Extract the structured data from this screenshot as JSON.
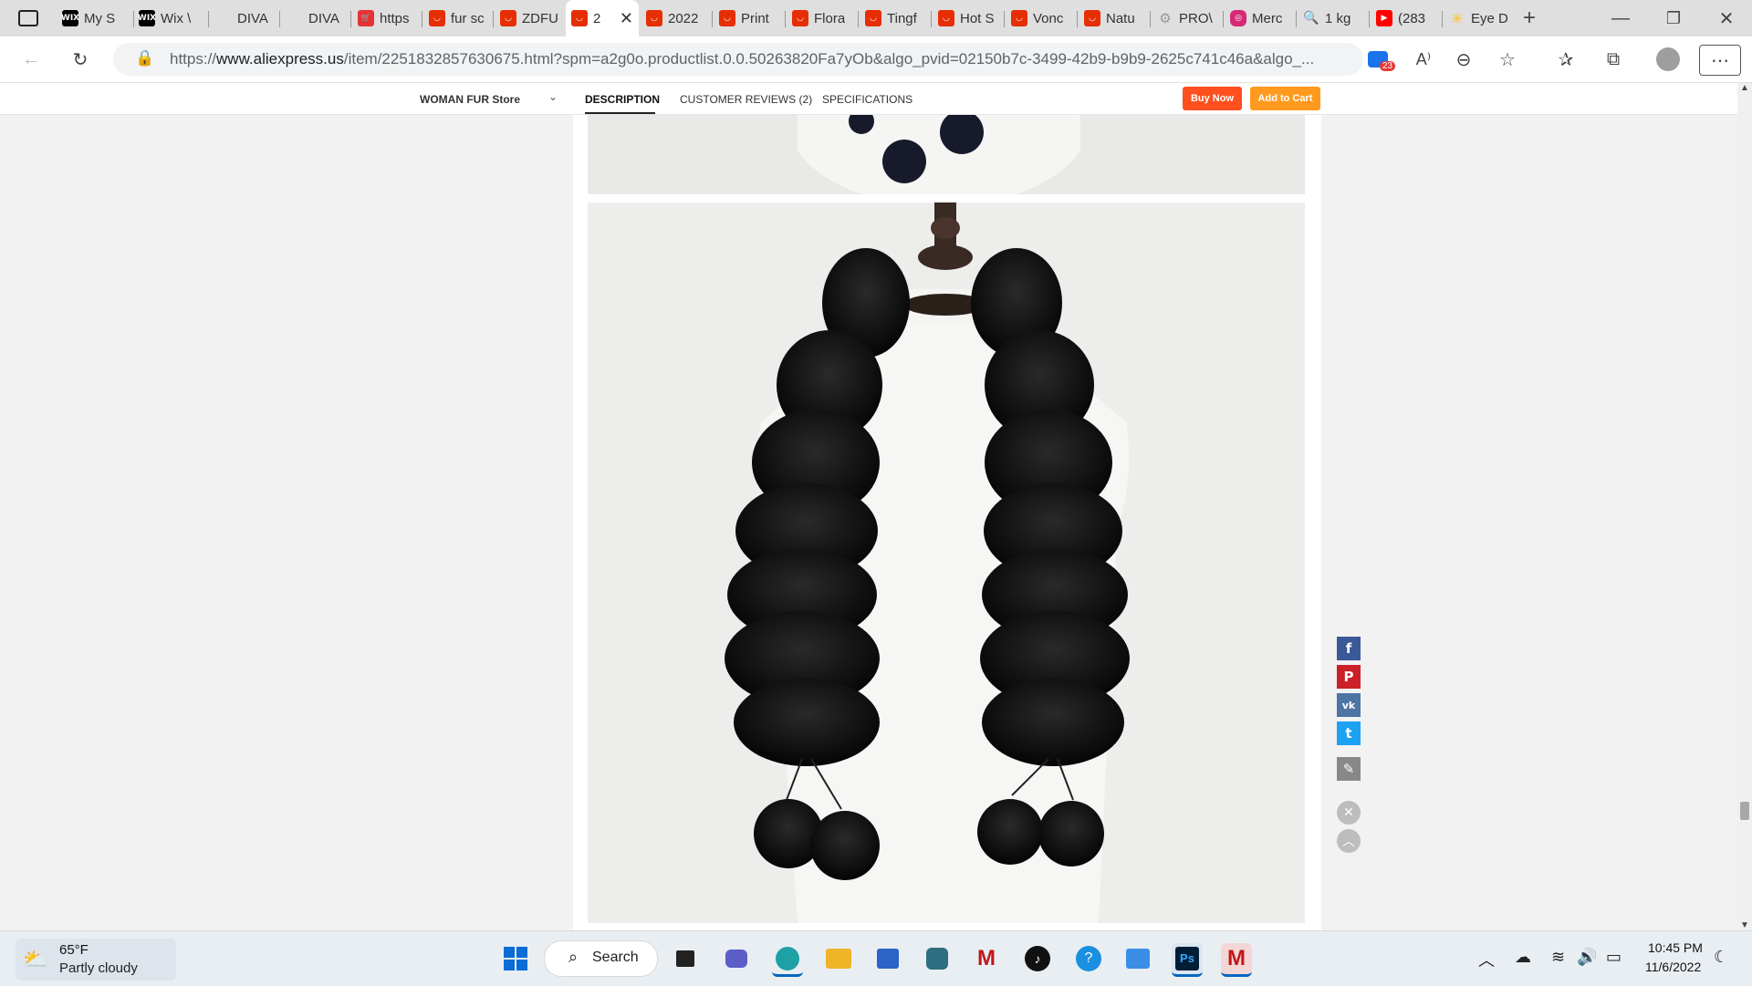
{
  "browser": {
    "tabs": [
      {
        "title": "",
        "icon": "window-menu-icon",
        "color": "#222222"
      },
      {
        "title": "My S",
        "icon": "wix-icon",
        "color": "#000000"
      },
      {
        "title": "Wix \\",
        "icon": "wix-icon",
        "color": "#000000"
      },
      {
        "title": "DIVA",
        "icon": "blank-icon",
        "color": "#dfdfdf"
      },
      {
        "title": "DIVA",
        "icon": "blank-icon",
        "color": "#dfdfdf"
      },
      {
        "title": "https",
        "icon": "cart-icon",
        "color": "#e63232"
      },
      {
        "title": "fur sc",
        "icon": "aliexpress-icon",
        "color": "#e62e04"
      },
      {
        "title": "ZDFU",
        "icon": "aliexpress-icon",
        "color": "#e62e04"
      },
      {
        "title": "2",
        "icon": "aliexpress-icon",
        "color": "#e62e04",
        "active": true
      },
      {
        "title": "2022",
        "icon": "aliexpress-icon",
        "color": "#e62e04"
      },
      {
        "title": "Print",
        "icon": "aliexpress-icon",
        "color": "#e62e04"
      },
      {
        "title": "Flora",
        "icon": "aliexpress-icon",
        "color": "#e62e04"
      },
      {
        "title": "Tingf",
        "icon": "aliexpress-icon",
        "color": "#e62e04"
      },
      {
        "title": "Hot S",
        "icon": "aliexpress-icon",
        "color": "#e62e04"
      },
      {
        "title": "Vonc",
        "icon": "aliexpress-icon",
        "color": "#e62e04"
      },
      {
        "title": "Natu",
        "icon": "aliexpress-icon",
        "color": "#e62e04"
      },
      {
        "title": "PRO\\",
        "icon": "gear-icon",
        "color": "#9a9a9a"
      },
      {
        "title": "Merc",
        "icon": "instagram-icon",
        "color": "#d62976"
      },
      {
        "title": "1 kg",
        "icon": "search-icon",
        "color": "#1a73e8"
      },
      {
        "title": "(283",
        "icon": "youtube-icon",
        "color": "#ff0000"
      },
      {
        "title": "Eye D",
        "icon": "walmart-icon",
        "color": "#ffc220"
      }
    ],
    "url_scheme": "https://",
    "url_domain": "www.aliexpress.us",
    "url_path": "/item/2251832857630675.html?spm=a2g0o.productlist.0.0.50263820Fa7yOb&algo_pvid=02150b7c-3499-42b9-b9b9-2625c741c46a&algo_...",
    "extension_badge": "23",
    "minimize": "—",
    "maximize": "❐",
    "close": "✕"
  },
  "nav": {
    "store": "WOMAN FUR Store",
    "description": "DESCRIPTION",
    "reviews": "CUSTOMER REVIEWS (2)",
    "specifications": "SPECIFICATIONS",
    "buy_now": "Buy Now",
    "add_to_cart": "Add to Cart"
  },
  "share": [
    {
      "name": "facebook",
      "glyph": "f",
      "color": "#3b5998"
    },
    {
      "name": "pinterest",
      "glyph": "P",
      "color": "#cb2027"
    },
    {
      "name": "vk",
      "glyph": "vk",
      "color": "#4c75a3"
    },
    {
      "name": "twitter",
      "glyph": "t",
      "color": "#1da1f2"
    },
    {
      "name": "edit",
      "glyph": "✎",
      "color": "#888888"
    }
  ],
  "taskbar": {
    "weather_temp": "65°F",
    "weather_desc": "Partly cloudy",
    "search": "Search",
    "time": "10:45 PM",
    "date": "11/6/2022"
  }
}
